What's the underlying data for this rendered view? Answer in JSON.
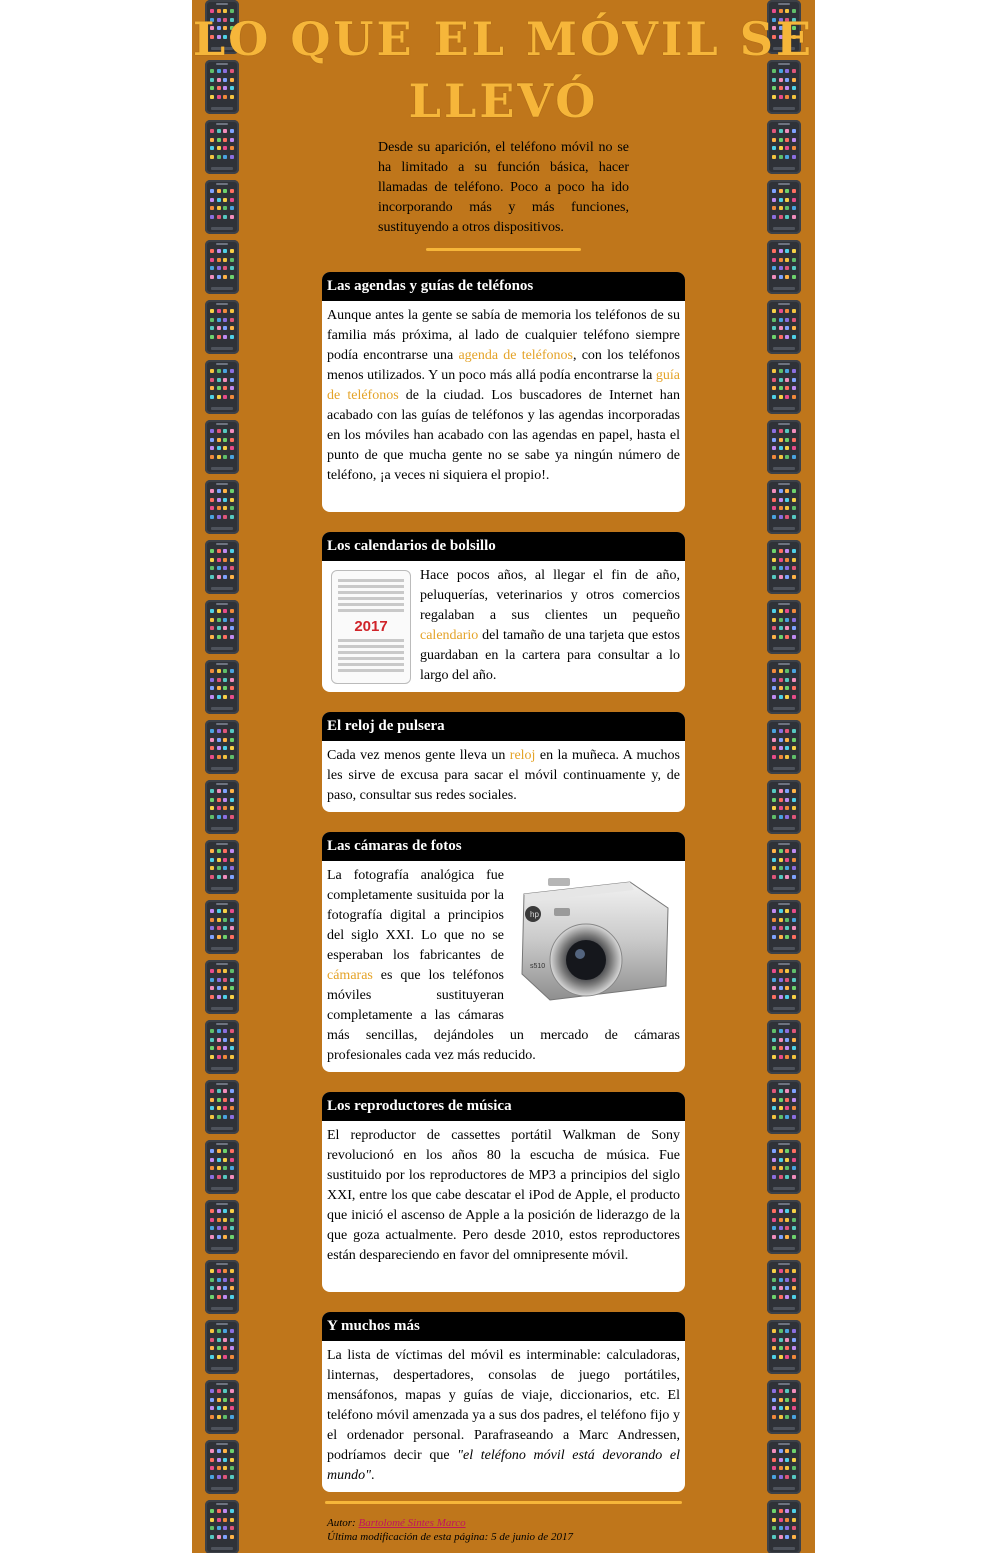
{
  "page": {
    "title": "Lo que el móvil se llevó",
    "intro": "Desde su aparición, el teléfono móvil no se ha limitado a su función básica, hacer llamadas de teléfono. Poco a poco ha ido incorporando más y más funciones, sustituyendo a otros dispositivos."
  },
  "sections": [
    {
      "heading": "Las agendas y guías de teléfonos",
      "t1": "Aunque antes la gente se sabía de memoria los teléfonos de su familia más próxima, al lado de cualquier teléfono siempre podía encontrarse una ",
      "link1": "agenda de teléfonos",
      "t2": ", con los teléfonos menos utilizados. Y un poco más allá podía encontrarse la ",
      "link2": "guía de teléfonos",
      "t3": " de la ciudad. Los buscadores de Internet han acabado con las guías de teléfonos y las agendas incorporadas en los móviles han acabado con las agendas en papel, hasta el punto de que mucha gente no se sabe ya ningún número de teléfono, ¡a veces ni siquiera el propio!."
    },
    {
      "heading": "Los calendarios de bolsillo",
      "image_text": "2017",
      "t1": "Hace pocos años, al llegar el fin de año, peluquerías, veterinarios y otros comercios regalaban a sus clientes un pequeño ",
      "link1": "calendario",
      "t2": " del tamaño de una tarjeta que estos guardaban en la cartera para consultar a lo largo del año."
    },
    {
      "heading": "El reloj de pulsera",
      "t1": "Cada vez menos gente lleva un ",
      "link1": "reloj",
      "t2": " en la muñeca. A muchos les sirve de excusa para sacar el móvil continuamente y, de paso, consultar sus redes sociales."
    },
    {
      "heading": "Las cámaras de fotos",
      "t1": "La fotografía analógica fue completamente susituida por la fotografía digital a principios del siglo XXI. Lo que no se esperaban los fabricantes de ",
      "link1": "cámaras",
      "t2": " es que los teléfonos móviles sustituyeran completamente a las cámaras más sencillas, dejándoles un mercado de cámaras profesionales cada vez más reducido."
    },
    {
      "heading": "Los reproductores de música",
      "t1": "El reproductor de cassettes portátil Walkman de Sony revolucionó en los años 80 la escucha de música. Fue sustituido por los reproductores de MP3 a principios del siglo XXI, entre los que cabe descatar el iPod de Apple, el producto que inició el ascenso de Apple a la posición de liderazgo de la que goza actualmente. Pero desde 2010, estos reproductores están despareciendo en favor del omnipresente móvil."
    },
    {
      "heading": "Y muchos más",
      "t1": "La lista de víctimas del móvil es interminable: calculadoras, linternas, despertadores, consolas de juego portátiles, mensáfonos, mapas y guías de viaje, diccionarios, etc. El teléfono móvil amenzada ya a sus dos padres, el teléfono fijo y el ordenador personal. Parafraseando a Marc Andressen, podríamos decir que ",
      "quote": "\"el teléfono móvil está devorando el mundo\"",
      "t2": "."
    }
  ],
  "footer": {
    "author_label": "Autor:",
    "author_name": "Bartolomé Sintes Marco",
    "modified_label": "Última modificación de esta página:",
    "modified_date": "5 de junio de 2017"
  },
  "colors": {
    "background": "#bf761b",
    "accent": "#f6b63a",
    "link": "#e4a328",
    "heading_bg": "#000000",
    "author_link": "#c0155d"
  },
  "icons": {
    "border": "smartphone-icon",
    "calendar_image": "pocket-calendar-image",
    "camera_image": "digital-camera-image"
  }
}
